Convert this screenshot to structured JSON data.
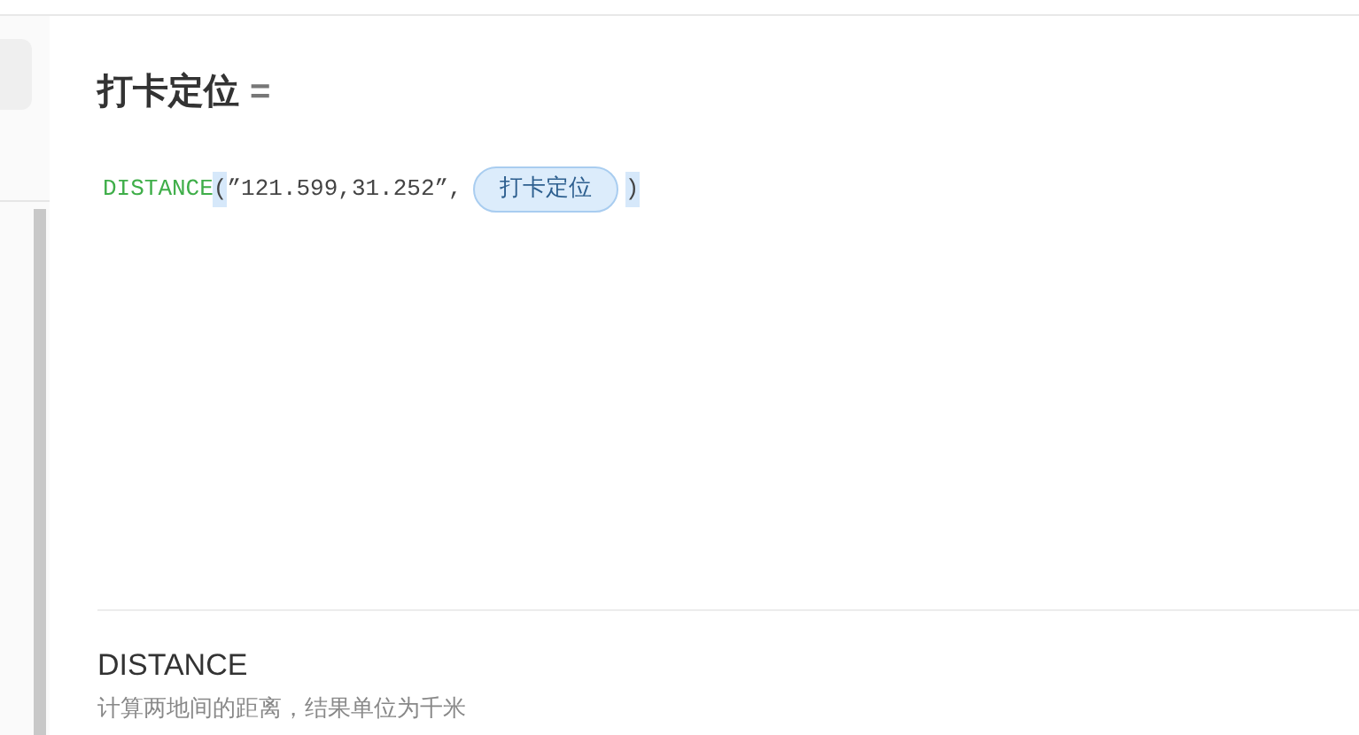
{
  "field_title": "打卡定位",
  "equals": "=",
  "formula": {
    "function": "DISTANCE",
    "open_paren": "(",
    "argument": "”121.599,31.252”,",
    "field_token": "打卡定位",
    "close_paren": ")"
  },
  "help": {
    "name": "DISTANCE",
    "description": "计算两地间的距离，结果单位为千米"
  }
}
